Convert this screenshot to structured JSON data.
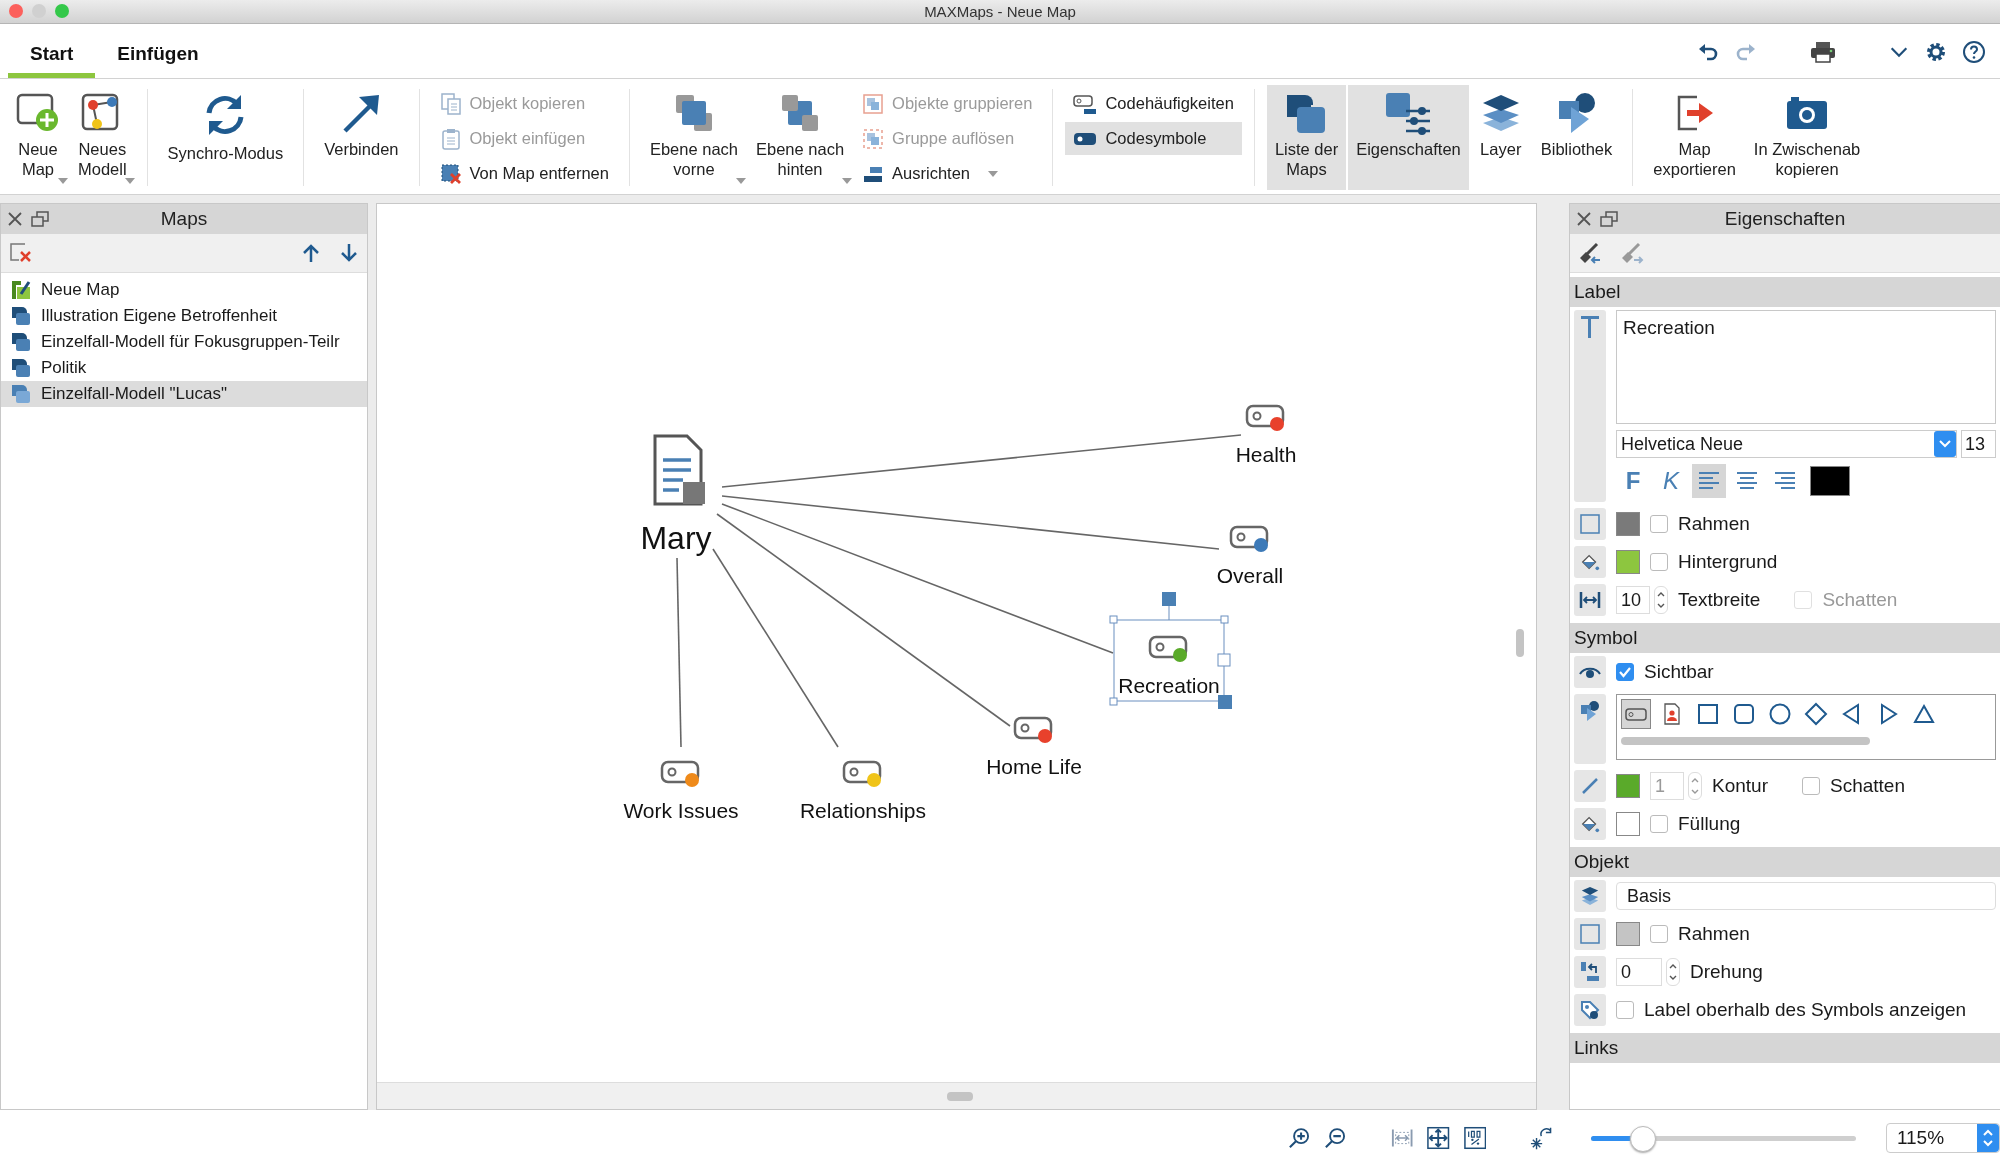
{
  "window": {
    "title": "MAXMaps - Neue Map"
  },
  "tabs": [
    {
      "label": "Start",
      "selected": true
    },
    {
      "label": "Einfügen",
      "selected": false
    }
  ],
  "ribbon": {
    "groups": [
      [
        {
          "kind": "large",
          "lines": [
            "Neue",
            "Map"
          ],
          "dropdown": true,
          "selected": false
        },
        {
          "kind": "large",
          "lines": [
            "Neues",
            "Modell"
          ],
          "dropdown": true,
          "selected": false
        }
      ],
      [
        {
          "kind": "large",
          "lines": [
            "Synchro-Modus"
          ],
          "dropdown": false,
          "selected": false
        }
      ],
      [
        {
          "kind": "large",
          "lines": [
            "Verbinden"
          ],
          "dropdown": false,
          "selected": false
        }
      ],
      [
        {
          "kind": "stack",
          "items": [
            {
              "label": "Objekt kopieren",
              "disabled": true,
              "selected": false,
              "dropdown": false
            },
            {
              "label": "Objekt einfügen",
              "disabled": true,
              "selected": false,
              "dropdown": false
            },
            {
              "label": "Von Map entfernen",
              "disabled": false,
              "selected": false,
              "dropdown": false
            }
          ]
        }
      ],
      [
        {
          "kind": "large",
          "lines": [
            "Ebene nach",
            "vorne"
          ],
          "dropdown": true,
          "selected": false
        },
        {
          "kind": "large",
          "lines": [
            "Ebene nach",
            "hinten"
          ],
          "dropdown": true,
          "selected": false
        },
        {
          "kind": "stack",
          "items": [
            {
              "label": "Objekte gruppieren",
              "disabled": true,
              "selected": false,
              "dropdown": false
            },
            {
              "label": "Gruppe auflösen",
              "disabled": true,
              "selected": false,
              "dropdown": false
            },
            {
              "label": "Ausrichten",
              "disabled": false,
              "selected": false,
              "dropdown": true
            }
          ]
        }
      ],
      [
        {
          "kind": "stack",
          "items": [
            {
              "label": "Codehäufigkeiten",
              "disabled": false,
              "selected": false,
              "dropdown": false
            },
            {
              "label": "Codesymbole",
              "disabled": false,
              "selected": true,
              "dropdown": false
            }
          ]
        }
      ],
      [
        {
          "kind": "large",
          "lines": [
            "Liste der",
            "Maps"
          ],
          "dropdown": false,
          "selected": true
        },
        {
          "kind": "large",
          "lines": [
            "Eigenschaften"
          ],
          "dropdown": false,
          "selected": true
        },
        {
          "kind": "large",
          "lines": [
            "Layer"
          ],
          "dropdown": false,
          "selected": false
        },
        {
          "kind": "large",
          "lines": [
            "Bibliothek"
          ],
          "dropdown": false,
          "selected": false
        }
      ],
      [
        {
          "kind": "large",
          "lines": [
            "Map",
            "exportieren"
          ],
          "dropdown": false,
          "selected": false
        },
        {
          "kind": "large",
          "lines": [
            "In Zwischenab",
            "kopieren"
          ],
          "dropdown": false,
          "selected": false
        }
      ]
    ]
  },
  "maps_panel": {
    "title": "Maps",
    "items": [
      {
        "label": "Neue Map",
        "kind": "edit",
        "selected": false
      },
      {
        "label": "Illustration Eigene Betroffenheit",
        "kind": "map",
        "selected": false
      },
      {
        "label": "Einzelfall-Modell für Fokusgruppen-Teilr",
        "kind": "map",
        "selected": false
      },
      {
        "label": "Politik",
        "kind": "map",
        "selected": false
      },
      {
        "label": "Einzelfall-Modell \"Lucas\"",
        "kind": "map",
        "selected": true
      }
    ]
  },
  "map": {
    "center": {
      "label": "Mary"
    },
    "nodes": [
      {
        "label": "Health",
        "color": "#e8412c",
        "selected": false
      },
      {
        "label": "Overall",
        "color": "#3d7ab8",
        "selected": false
      },
      {
        "label": "Recreation",
        "color": "#5aaa2a",
        "selected": true
      },
      {
        "label": "Home Life",
        "color": "#e8412c",
        "selected": false
      },
      {
        "label": "Relationships",
        "color": "#f0c419",
        "selected": false
      },
      {
        "label": "Work Issues",
        "color": "#ef8a1a",
        "selected": false
      }
    ]
  },
  "properties": {
    "title": "Eigenschaften",
    "label": {
      "heading": "Label",
      "text": "Recreation",
      "font": "Helvetica Neue",
      "size": "13",
      "bold": "F",
      "italic": "K",
      "align": [
        {
          "kind": "left",
          "selected": true
        },
        {
          "kind": "center",
          "selected": false
        },
        {
          "kind": "right",
          "selected": false
        }
      ],
      "rows": [
        {
          "label": "Rahmen",
          "checked": false,
          "color": "#7a7a7a"
        },
        {
          "label": "Hintergrund",
          "checked": false,
          "color": "#8dc63f"
        }
      ],
      "width": {
        "value": "10",
        "label": "Textbreite"
      },
      "shadow": {
        "label": "Schatten",
        "checked": false,
        "disabled": true
      }
    },
    "symbol": {
      "heading": "Symbol",
      "visible": {
        "label": "Sichtbar",
        "checked": true
      },
      "shapes": [
        {
          "kind": "code",
          "selected": true
        },
        {
          "kind": "person",
          "selected": false
        },
        {
          "kind": "square",
          "selected": false
        },
        {
          "kind": "rounded",
          "selected": false
        },
        {
          "kind": "circle",
          "selected": false
        },
        {
          "kind": "diamond",
          "selected": false
        },
        {
          "kind": "left",
          "selected": false
        },
        {
          "kind": "right",
          "selected": false
        },
        {
          "kind": "up",
          "selected": false
        }
      ],
      "stroke": {
        "color": "#5aaa2a",
        "value": "1",
        "label": "Kontur",
        "disabled": true
      },
      "shadow": {
        "label": "Schatten",
        "checked": false
      },
      "fill": {
        "color": "#ffffff",
        "label": "Füllung",
        "checked": false
      }
    },
    "object": {
      "heading": "Objekt",
      "layer": "Basis",
      "frame": {
        "label": "Rahmen",
        "checked": false,
        "color": "#c4c4c4"
      },
      "rotation": {
        "value": "0",
        "label": "Drehung"
      },
      "label_above": {
        "label": "Label oberhalb des Symbols anzeigen",
        "checked": false
      }
    },
    "links": {
      "heading": "Links"
    }
  },
  "zoom": {
    "level": 0.22,
    "value": "115%"
  }
}
